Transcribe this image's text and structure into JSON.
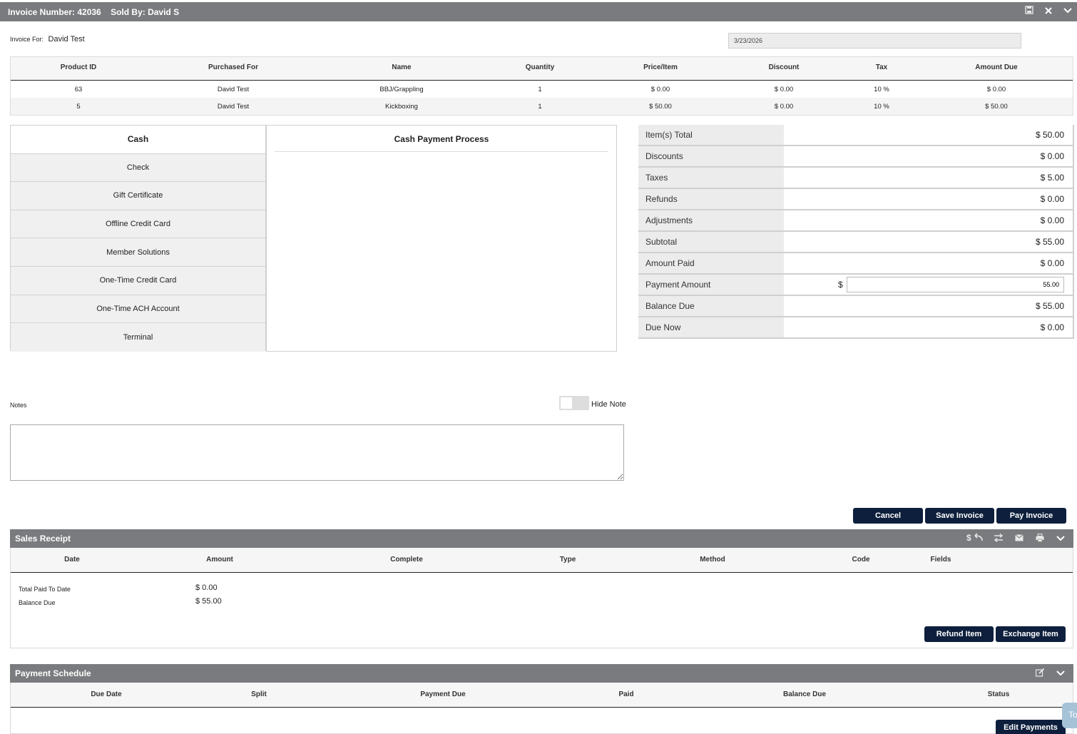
{
  "header": {
    "invoice_number": "Invoice Number: 42036",
    "sold_by": "Sold By: David S",
    "icons": [
      "save-icon",
      "close-icon",
      "chevron-down-icon"
    ]
  },
  "invoice_for": {
    "label": "Invoice For:",
    "name": "David Test"
  },
  "date": "3/23/2026",
  "items": {
    "columns": [
      "Product ID",
      "Purchased For",
      "Name",
      "Quantity",
      "Price/Item",
      "Discount",
      "Tax",
      "Amount Due"
    ],
    "rows": [
      [
        "63",
        "David Test",
        "BBJ/Grappling",
        "1",
        "$ 0.00",
        "$ 0.00",
        "10 %",
        "$ 0.00"
      ],
      [
        "5",
        "David Test",
        "Kickboxing",
        "1",
        "$ 50.00",
        "$ 0.00",
        "10 %",
        "$ 50.00"
      ]
    ]
  },
  "payment_methods": [
    "Cash",
    "Check",
    "Gift Certificate",
    "Offline Credit Card",
    "Member Solutions",
    "One-Time Credit Card",
    "One-Time ACH Account",
    "Terminal"
  ],
  "process_title": "Cash Payment Process",
  "totals": {
    "items_total": {
      "label": "Item(s) Total",
      "value": "$ 50.00"
    },
    "discounts": {
      "label": "Discounts",
      "value": "$ 0.00"
    },
    "taxes": {
      "label": "Taxes",
      "value": "$ 5.00"
    },
    "refunds": {
      "label": "Refunds",
      "value": "$ 0.00"
    },
    "adjustments": {
      "label": "Adjustments",
      "value": "$ 0.00"
    },
    "subtotal": {
      "label": "Subtotal",
      "value": "$ 55.00"
    },
    "amount_paid": {
      "label": "Amount Paid",
      "value": "$ 0.00"
    },
    "payment_amount": {
      "label": "Payment Amount",
      "currency": "$",
      "value": "55.00"
    },
    "balance_due": {
      "label": "Balance Due",
      "value": "$ 55.00"
    },
    "due_now": {
      "label": "Due Now",
      "value": "$ 0.00"
    }
  },
  "notes": {
    "label": "Notes",
    "hide_note": "Hide Note",
    "value": ""
  },
  "actions": {
    "cancel": "Cancel",
    "save": "Save Invoice",
    "pay": "Pay Invoice"
  },
  "sales_receipt": {
    "title": "Sales Receipt",
    "columns": [
      "Date",
      "Amount",
      "Complete",
      "Type",
      "Method",
      "Code",
      "Fields"
    ],
    "total_paid_label": "Total Paid To Date",
    "total_paid_value": "$ 0.00",
    "balance_label": "Balance Due",
    "balance_value": "$ 55.00",
    "refund_button": "Refund Item",
    "exchange_button": "Exchange Item"
  },
  "payment_schedule": {
    "title": "Payment Schedule",
    "columns": [
      "Due Date",
      "Split",
      "Payment Due",
      "Paid",
      "Balance Due",
      "Status"
    ],
    "edit_button": "Edit Payments"
  },
  "corner_tab": "To"
}
